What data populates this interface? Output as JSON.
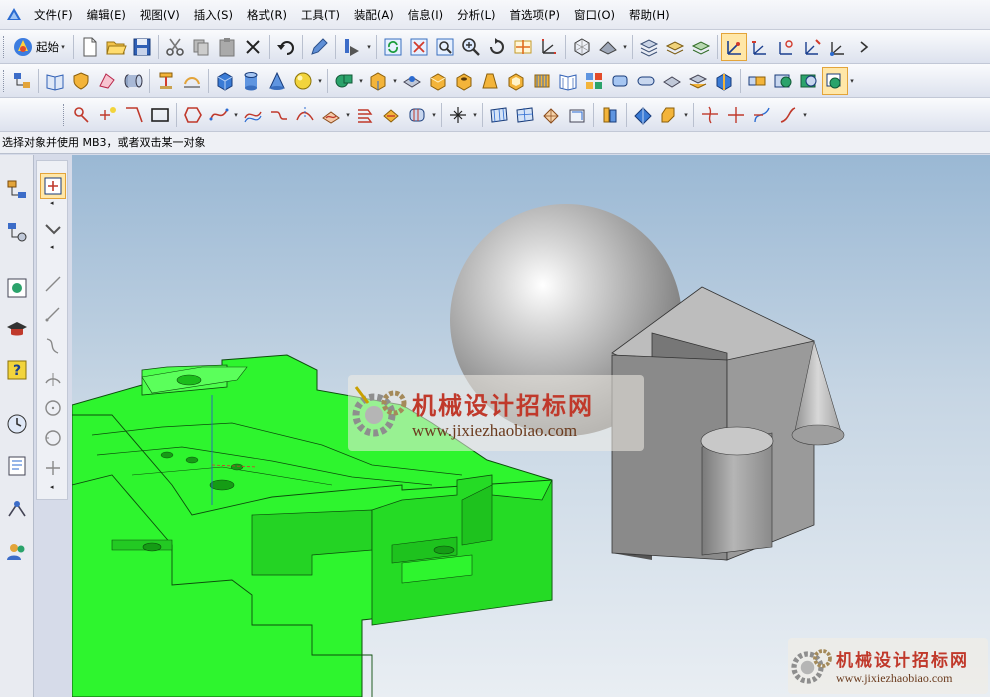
{
  "menu": {
    "items": [
      "文件(F)",
      "编辑(E)",
      "视图(V)",
      "插入(S)",
      "格式(R)",
      "工具(T)",
      "装配(A)",
      "信息(I)",
      "分析(L)",
      "首选项(P)",
      "窗口(O)",
      "帮助(H)"
    ]
  },
  "toolbar": {
    "start_label": "起始"
  },
  "cue_line": {
    "text": "选择对象并使用 MB3，或者双击某一对象"
  },
  "watermark": {
    "name": "机械设计招标网",
    "url": "www.jixiezhaobiao.com"
  },
  "colors": {
    "model_green": "#2ef52e",
    "model_gray": "#8e8e8e",
    "accent_orange": "#e3a43a"
  }
}
